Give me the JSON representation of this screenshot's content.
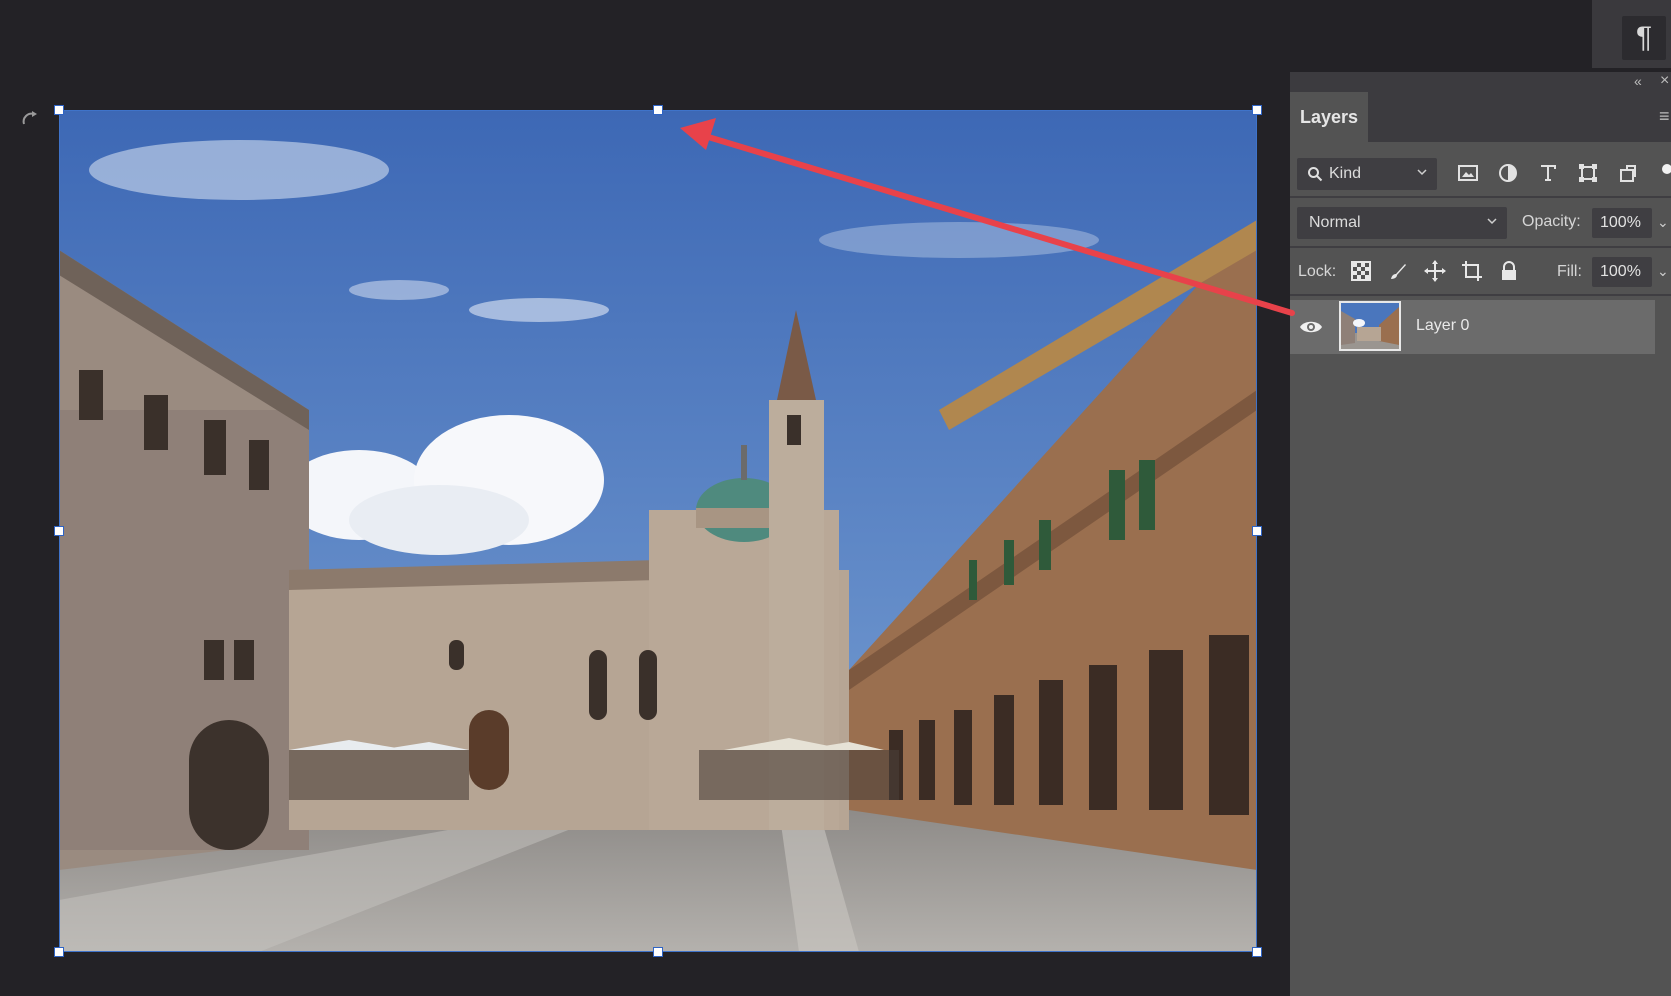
{
  "toolbar": {
    "paragraph_icon": "¶"
  },
  "layers_panel": {
    "tab_label": "Layers",
    "collapse_icon": "«",
    "close_icon": "×",
    "menu_icon": "≡",
    "filter": {
      "kind_label": "Kind"
    },
    "filter_icons": [
      "image-filter-icon",
      "adjustment-filter-icon",
      "type-filter-icon",
      "shape-filter-icon",
      "smart-object-filter-icon",
      "toggle-filter-icon"
    ],
    "blend_mode": "Normal",
    "opacity_label": "Opacity:",
    "opacity_value": "100%",
    "lock_label": "Lock:",
    "lock_icons": [
      "lock-transparent-pixels-icon",
      "lock-image-pixels-icon",
      "lock-position-icon",
      "lock-artboard-icon",
      "lock-all-icon"
    ],
    "fill_label": "Fill:",
    "fill_value": "100%",
    "layers": [
      {
        "name": "Layer 0",
        "visible": true,
        "selected": true
      }
    ]
  },
  "colors": {
    "app_background": "#232226",
    "panel_background": "#535353",
    "selected_layer": "#6b6b6b",
    "transform_box": "#3f73c9",
    "annotation_arrow": "#e8424a"
  }
}
